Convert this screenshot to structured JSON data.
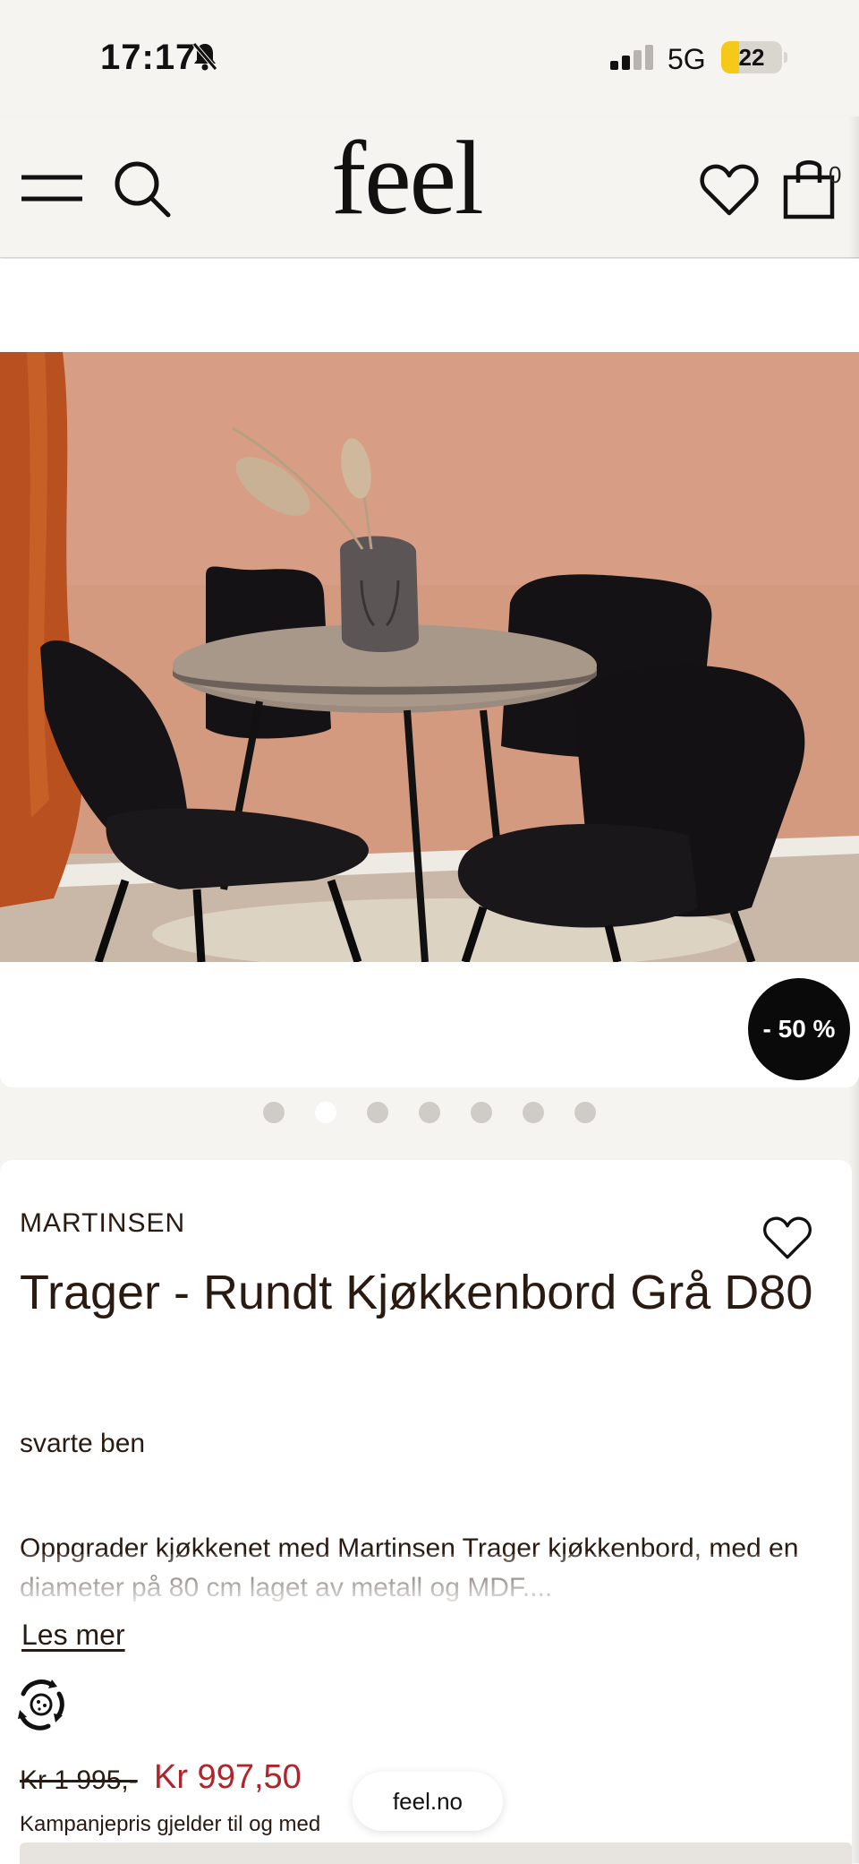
{
  "status_bar": {
    "time": "17:17",
    "network": "5G",
    "battery": "22"
  },
  "header": {
    "logo": "feel",
    "cart_count": "0"
  },
  "gallery": {
    "discount_badge": "- 50 %",
    "image_count": 7,
    "active_index": 1
  },
  "product": {
    "brand": "MARTINSEN",
    "title": "Trager - Rundt Kjøkkenbord Grå D80",
    "variant": "svarte ben",
    "description": "Oppgrader kjøkkenet med Martinsen Trager kjøkkenbord, med en diameter på 80 cm laget av metall og MDF....",
    "read_more": "Les mer",
    "old_price": "Kr 1 995,-",
    "new_price": "Kr 997,50",
    "campaign_note": "Kampanjepris gjelder til og med"
  },
  "browser": {
    "url": "feel.no"
  },
  "colors": {
    "background": "#f6f4f1",
    "text": "#2a1b12",
    "sale_price": "#b0242c",
    "battery_fill": "#f5c918"
  }
}
